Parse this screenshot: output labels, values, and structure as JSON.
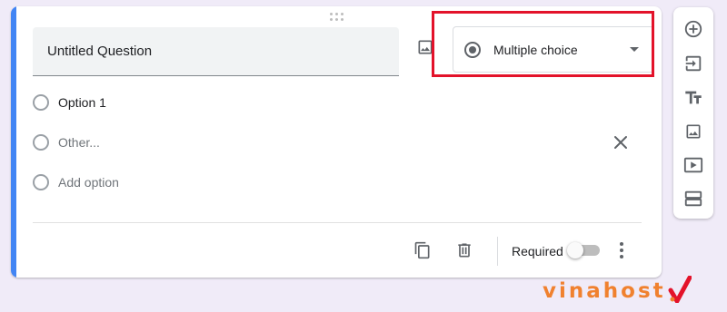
{
  "question": {
    "title": "Untitled Question",
    "type_label": "Multiple choice"
  },
  "options": [
    {
      "label": "Option 1"
    },
    {
      "label": "Other..."
    },
    {
      "label": "Add option"
    }
  ],
  "footer": {
    "required_label": "Required",
    "required_on": false
  },
  "side_toolbar": {
    "icons": [
      "add-question-icon",
      "import-questions-icon",
      "add-title-icon",
      "add-image-icon",
      "add-video-icon",
      "add-section-icon"
    ]
  },
  "branding": {
    "logo_text": "vinahost",
    "accent_color": "#4285f4",
    "highlight_color": "#e3122a",
    "logo_color": "#f0812f"
  }
}
